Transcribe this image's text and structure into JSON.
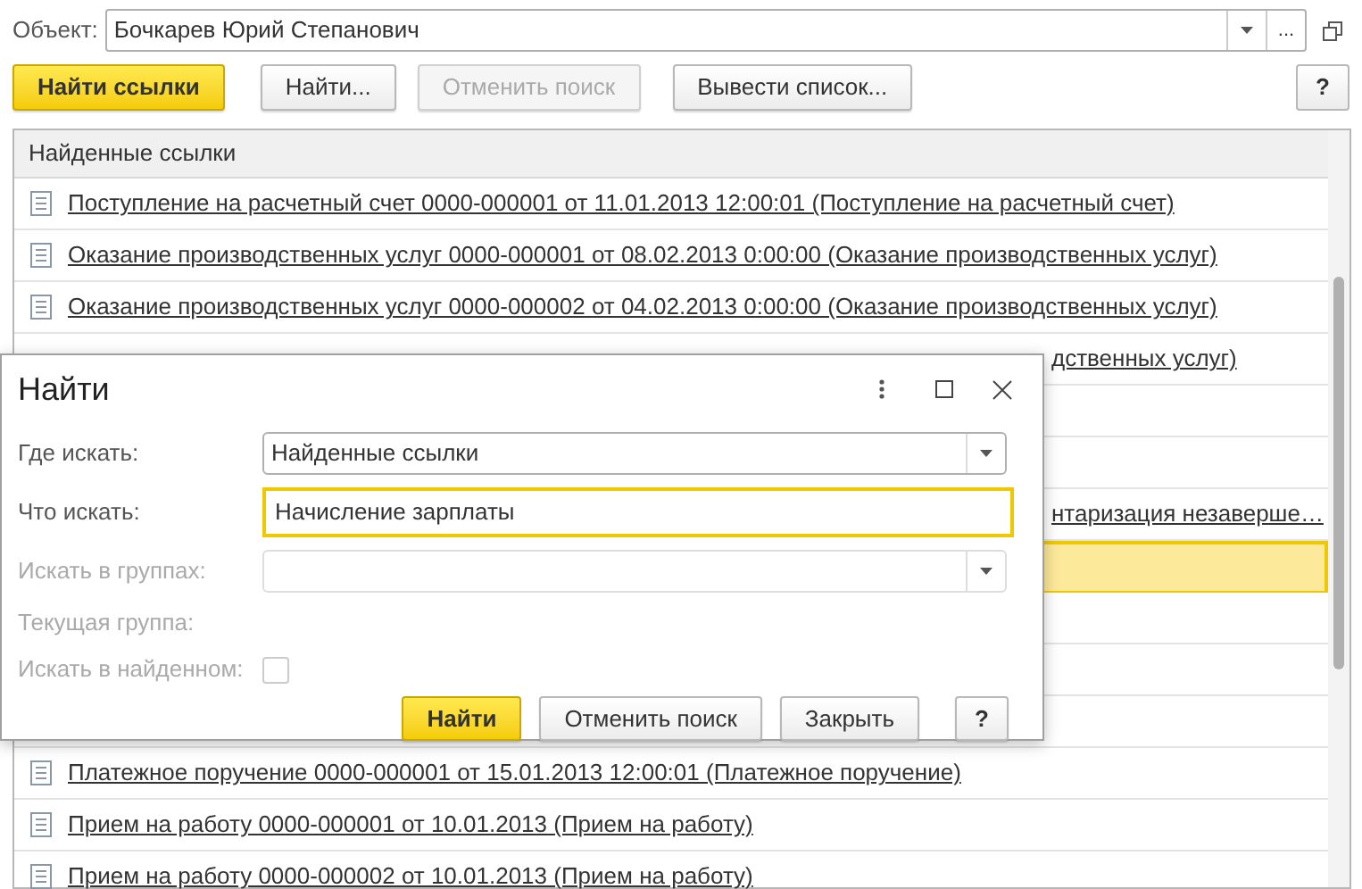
{
  "object_field": {
    "label": "Объект:",
    "value": "Бочкарев Юрий Степанович",
    "more": "..."
  },
  "toolbar": [
    {
      "label": "Найти ссылки",
      "kind": "primary",
      "disabled": false
    },
    {
      "label": "Найти...",
      "kind": "normal",
      "disabled": false
    },
    {
      "label": "Отменить поиск",
      "kind": "normal",
      "disabled": true
    },
    {
      "label": "Вывести список...",
      "kind": "normal",
      "disabled": false
    }
  ],
  "help": "?",
  "list": {
    "header": "Найденные ссылки",
    "rows": [
      {
        "text": "Поступление на расчетный счет 0000-000001 от 11.01.2013 12:00:01 (Поступление на расчетный счет)",
        "covered": false,
        "selected": false
      },
      {
        "text": "Оказание производственных услуг 0000-000001 от 08.02.2013 0:00:00 (Оказание производственных услуг)",
        "covered": false,
        "selected": false
      },
      {
        "text": "Оказание производственных услуг 0000-000002 от 04.02.2013 0:00:00 (Оказание производственных услуг)",
        "covered": false,
        "selected": false
      },
      {
        "text": "дственных услуг)",
        "covered": true,
        "selected": false
      },
      {
        "covered": true,
        "selected": false
      },
      {
        "covered": true,
        "selected": false
      },
      {
        "text": "нтаризация незаверше…",
        "covered": true,
        "selected": false
      },
      {
        "covered": true,
        "selected": true
      },
      {
        "covered": true,
        "selected": false
      },
      {
        "covered": true,
        "selected": false
      },
      {
        "covered": true,
        "selected": false
      },
      {
        "text": "Платежное поручение 0000-000001 от 15.01.2013 12:00:01 (Платежное поручение)",
        "covered": false,
        "selected": false
      },
      {
        "text": "Прием на работу 0000-000001 от 10.01.2013 (Прием на работу)",
        "covered": false,
        "selected": false
      },
      {
        "text": "Прием на работу 0000-000002 от 10.01.2013 (Прием на работу)",
        "covered": false,
        "selected": false
      }
    ]
  },
  "dialog": {
    "title": "Найти",
    "fields": [
      {
        "label": "Где искать:",
        "kind": "select",
        "value": "Найденные ссылки",
        "disabled": false,
        "focused": false
      },
      {
        "label": "Что искать:",
        "kind": "text",
        "value": "Начисление зарплаты",
        "disabled": false,
        "focused": true
      },
      {
        "label": "Искать в группах:",
        "kind": "select",
        "disabled": true,
        "focused": false
      },
      {
        "label": "Текущая группа:",
        "kind": "label",
        "disabled": true
      },
      {
        "label": "Искать в найденном:",
        "kind": "checkbox",
        "checked": false,
        "disabled": true
      }
    ],
    "buttons": [
      {
        "label": "Найти",
        "kind": "primary"
      },
      {
        "label": "Отменить поиск",
        "kind": "normal"
      },
      {
        "label": "Закрыть",
        "kind": "normal"
      },
      {
        "label": "?",
        "kind": "help"
      }
    ]
  }
}
